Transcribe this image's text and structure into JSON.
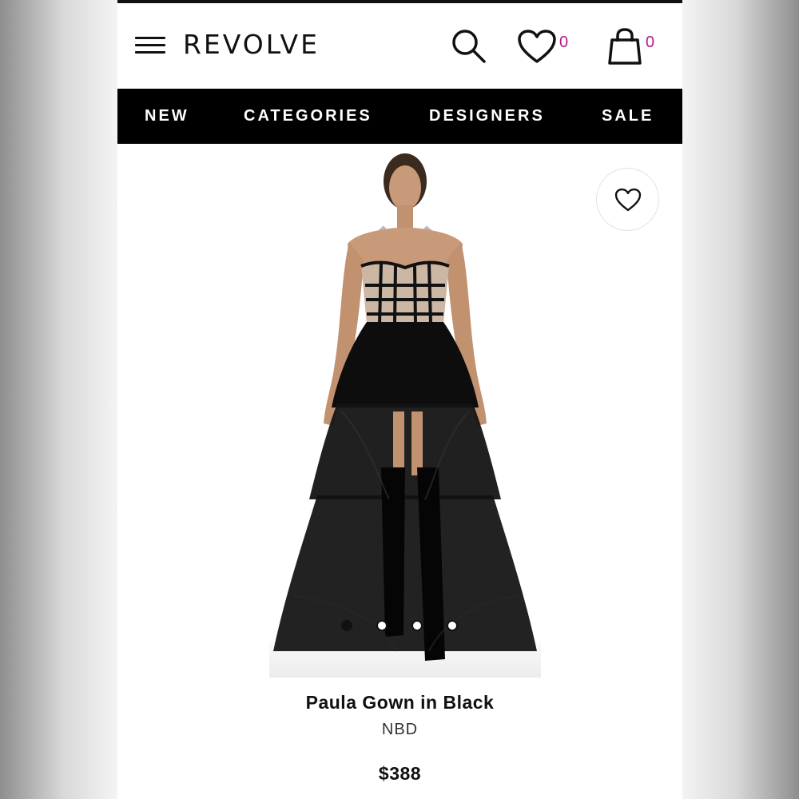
{
  "header": {
    "logo": "REVOLVE",
    "wishlist_count": "0",
    "bag_count": "0"
  },
  "nav": {
    "items": [
      "NEW",
      "CATEGORIES",
      "DESIGNERS",
      "SALE"
    ]
  },
  "product": {
    "title": "Paula Gown in Black",
    "brand": "NBD",
    "price": "$388",
    "image_count": 4,
    "active_image": 1
  },
  "icons": {
    "menu": "hamburger-icon",
    "search": "search-icon",
    "wishlist": "heart-icon",
    "bag": "shopping-bag-icon"
  },
  "colors": {
    "accent_count": "#b0188f",
    "nav_bg": "#000000"
  }
}
